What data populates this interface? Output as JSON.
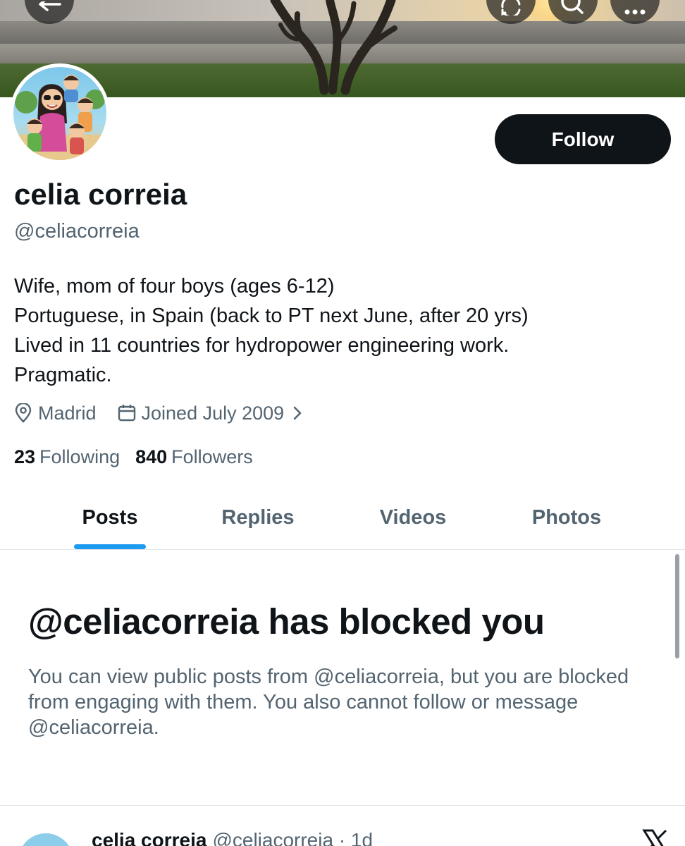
{
  "header": {
    "back_icon": "arrow-left-icon",
    "refresh_icon": "refresh-icon",
    "search_icon": "search-icon",
    "more_icon": "more-horizontal-icon"
  },
  "profile": {
    "display_name": "celia correia",
    "handle": "@celiacorreia",
    "follow_label": "Follow",
    "bio_lines": [
      "Wife, mom of four boys (ages 6-12)",
      "Portuguese, in Spain (back to PT next June, after 20 yrs)",
      "Lived in 11 countries for hydropower engineering work.",
      "Pragmatic."
    ],
    "location": "Madrid",
    "joined": "Joined July 2009",
    "following_count": "23",
    "following_label": "Following",
    "followers_count": "840",
    "followers_label": "Followers"
  },
  "tabs": [
    {
      "label": "Posts",
      "active": true
    },
    {
      "label": "Replies",
      "active": false
    },
    {
      "label": "Videos",
      "active": false
    },
    {
      "label": "Photos",
      "active": false
    }
  ],
  "blocked": {
    "title": "@celiacorreia has blocked you",
    "description": "You can view public posts from @celiacorreia, but you are blocked from engaging with them. You also cannot follow or message @celiacorreia."
  },
  "post_preview": {
    "name": "celia correia",
    "handle_time": "@celiacorreia · 1d"
  },
  "colors": {
    "accent": "#1d9bf0",
    "text_primary": "#0f1419",
    "text_secondary": "#536471",
    "follow_bg": "#0f1419"
  }
}
